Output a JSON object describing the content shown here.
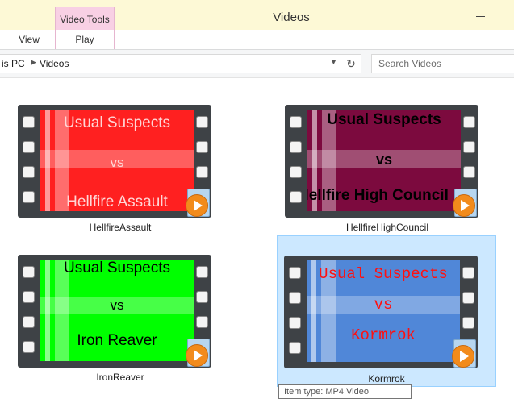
{
  "window": {
    "title": "Videos",
    "context_tab": "Video Tools"
  },
  "ribbon": {
    "tabs": [
      "View",
      "Play"
    ]
  },
  "address": {
    "crumbs": [
      "is PC",
      "Videos"
    ]
  },
  "search": {
    "placeholder": "Search Videos"
  },
  "items": [
    {
      "name": "HellfireAssault",
      "line1": "Usual Suspects",
      "line2": "vs",
      "line3": "Hellfire Assault",
      "color": "#ff2020"
    },
    {
      "name": "HellfireHighCouncil",
      "line1": "Usual Suspects",
      "line2": "vs",
      "line3": "Hellfire High Council",
      "color": "#7c0a3e"
    },
    {
      "name": "IronReaver",
      "line1": "Usual Suspects",
      "line2": "vs",
      "line3": "Iron Reaver",
      "color": "#00ff00"
    },
    {
      "name": "Kormrok",
      "line1": "Usual Suspects",
      "line2": "vs",
      "line3": "Kormrok",
      "color": "#5087d8"
    }
  ],
  "tooltip": {
    "text": "Item type: MP4 Video"
  }
}
